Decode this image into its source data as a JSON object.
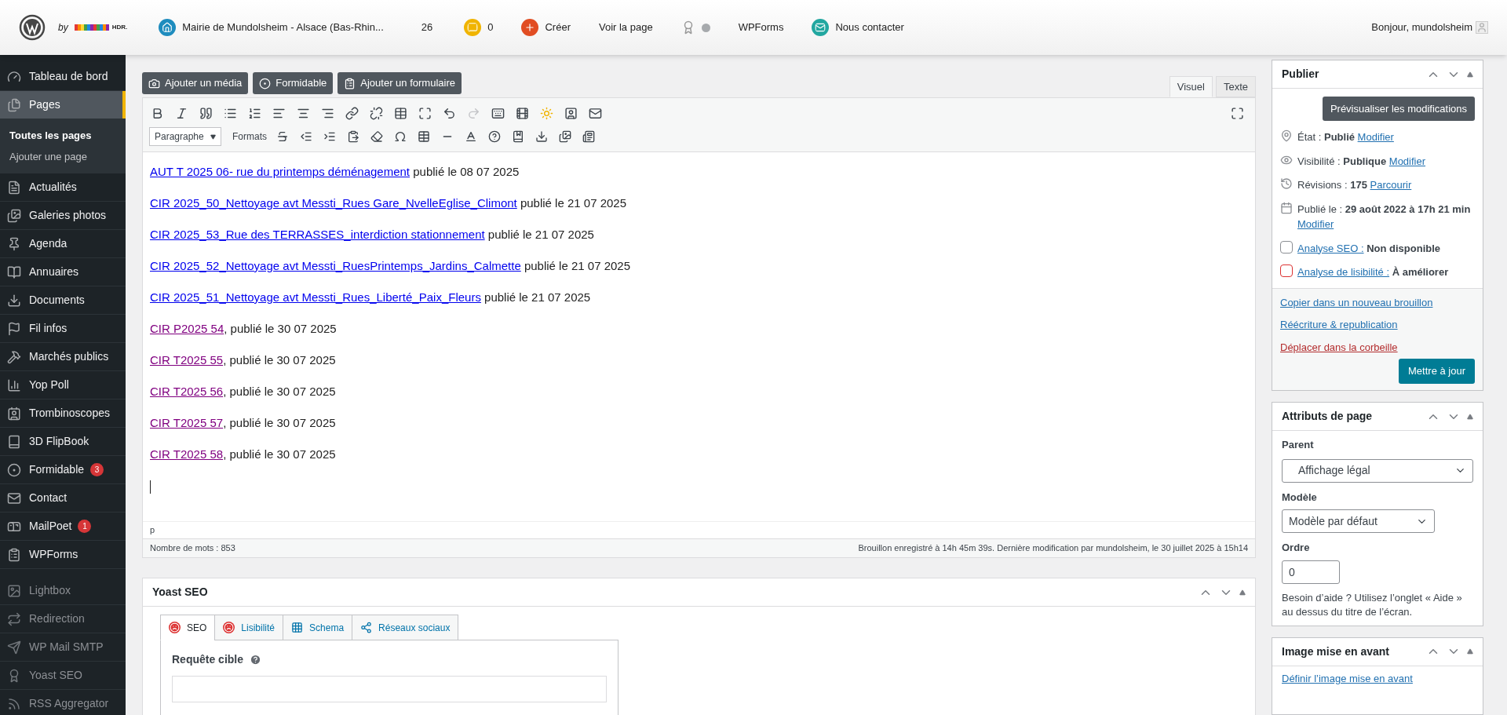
{
  "topbar": {
    "by": "by",
    "brand": "HDR.",
    "site": "Mairie de Mundolsheim - Alsace (Bas-Rhin...",
    "updates": "26",
    "comments": "0",
    "create": "Créer",
    "view": "Voir la page",
    "yoast_status": {
      "color": "#a7aaad"
    },
    "wpforms": "WPForms",
    "contact": "Nous contacter",
    "greeting": "Bonjour, mundolsheim"
  },
  "sidebar": {
    "items": [
      {
        "label": "Tableau de bord",
        "selected": false,
        "dimmed": false
      },
      {
        "label": "Pages",
        "selected": true,
        "dimmed": false,
        "children": [
          {
            "label": "Toutes les pages",
            "selected": true
          },
          {
            "label": "Ajouter une page",
            "selected": false
          }
        ]
      },
      {
        "label": "Actualités",
        "selected": false,
        "dimmed": false
      },
      {
        "label": "Galeries photos",
        "selected": false,
        "dimmed": false
      },
      {
        "label": "Agenda",
        "selected": false,
        "dimmed": false
      },
      {
        "label": "Annuaires",
        "selected": false,
        "dimmed": false
      },
      {
        "label": "Documents",
        "selected": false,
        "dimmed": false
      },
      {
        "label": "Fil infos",
        "selected": false,
        "dimmed": false
      },
      {
        "label": "Marchés publics",
        "selected": false,
        "dimmed": false
      },
      {
        "label": "Yop Poll",
        "selected": false,
        "dimmed": false
      },
      {
        "label": "Trombinoscopes",
        "selected": false,
        "dimmed": false
      },
      {
        "label": "3D FlipBook",
        "selected": false,
        "dimmed": false
      },
      {
        "label": "Formidable",
        "selected": false,
        "dimmed": false,
        "badge": "3"
      },
      {
        "label": "Contact",
        "selected": false,
        "dimmed": false
      },
      {
        "label": "MailPoet",
        "selected": false,
        "dimmed": false,
        "badge": "1"
      },
      {
        "label": "WPForms",
        "selected": false,
        "dimmed": false
      },
      {
        "label": "Lightbox",
        "selected": false,
        "dimmed": true
      },
      {
        "label": "Redirection",
        "selected": false,
        "dimmed": true
      },
      {
        "label": "WP Mail SMTP",
        "selected": false,
        "dimmed": true
      },
      {
        "label": "Yoast SEO",
        "selected": false,
        "dimmed": true
      },
      {
        "label": "RSS Aggregator",
        "selected": false,
        "dimmed": true
      }
    ]
  },
  "editor": {
    "media_buttons": [
      "Ajouter un média",
      "Formidable",
      "Ajouter un formulaire"
    ],
    "mode_tabs": [
      {
        "label": "Visuel",
        "selected": true
      },
      {
        "label": "Texte",
        "selected": false
      }
    ],
    "format_select": "Paragraphe",
    "formats_menu": "Formats",
    "content": [
      {
        "link": "AUT T 2025 06- rue du printemps déménagement",
        "visited": false,
        "text": " publié le 08 07 2025"
      },
      {
        "link": "CIR 2025_50_Nettoyage avt Messti_Rues Gare_NvelleEglise_Climont",
        "visited": false,
        "text": " publié le 21 07 2025"
      },
      {
        "link": "CIR 2025_53_Rue des TERRASSES_interdiction stationnement",
        "visited": false,
        "text": " publié le 21 07 2025"
      },
      {
        "link": "CIR 2025_52_Nettoyage avt Messti_RuesPrintemps_Jardins_Calmette",
        "visited": false,
        "text": " publié le 21 07 2025"
      },
      {
        "link": "CIR 2025_51_Nettoyage avt Messti_Rues_Liberté_Paix_Fleurs",
        "visited": false,
        "text": " publié le 21 07 2025"
      },
      {
        "link": "CIR P2025 54",
        "visited": true,
        "text": ", publié le 30 07 2025"
      },
      {
        "link": "CIR T2025 55",
        "visited": true,
        "text": ", publié le 30 07 2025"
      },
      {
        "link": "CIR T2025 56",
        "visited": true,
        "text": ", publié le 30 07 2025"
      },
      {
        "link": "CIR T2025 57",
        "visited": true,
        "text": ", publié le 30 07 2025"
      },
      {
        "link": "CIR T2025 58",
        "visited": true,
        "text": ", publié le 30 07 2025"
      }
    ],
    "path": "p",
    "word_count": "Nombre de mots : 853",
    "autosave": "Brouillon enregistré à 14h 45m 39s. Dernière modification par mundolsheim, le 30 juillet 2025 à 15h14"
  },
  "yoast": {
    "title": "Yoast SEO",
    "tabs": [
      {
        "label": "SEO",
        "selected": true,
        "kind": "score",
        "color": "#dc3232"
      },
      {
        "label": "Lisibilité",
        "selected": false,
        "kind": "score",
        "color": "#dc3232"
      },
      {
        "label": "Schema",
        "selected": false,
        "kind": "schema"
      },
      {
        "label": "Réseaux sociaux",
        "selected": false,
        "kind": "social"
      }
    ],
    "focus_label": "Requête cible"
  },
  "publish": {
    "title": "Publier",
    "preview": "Prévisualiser les modifications",
    "rows": [
      {
        "label": "État : ",
        "value": "Publié",
        "link": "Modifier"
      },
      {
        "label": "Visibilité : ",
        "value": "Publique",
        "link": "Modifier"
      },
      {
        "label": "Révisions : ",
        "value": "175",
        "link": "Parcourir"
      },
      {
        "label": "Publié le : ",
        "value": "29 août 2022 à 17h 21 min",
        "link": "Modifier"
      },
      {
        "link_first": "Analyse SEO :",
        "value": "Non disponible",
        "kind": "seo"
      },
      {
        "link_first": "Analyse de lisibilité :",
        "value": "À améliorer",
        "kind": "readability"
      }
    ],
    "actions": [
      {
        "label": "Copier dans un nouveau brouillon",
        "danger": false
      },
      {
        "label": "Réécriture & republication",
        "danger": false
      },
      {
        "label": "Déplacer dans la corbeille",
        "danger": true
      }
    ],
    "update": "Mettre à jour"
  },
  "attributes": {
    "title": "Attributs de page",
    "parent_label": "Parent",
    "parent": "Affichage légal",
    "template_label": "Modèle",
    "template": "Modèle par défaut",
    "order_label": "Ordre",
    "order": "0",
    "help": "Besoin d’aide ? Utilisez l’onglet « Aide » au dessus du titre de l’écran."
  },
  "featured": {
    "title": "Image mise en avant",
    "link": "Définir l’image mise en avant"
  }
}
